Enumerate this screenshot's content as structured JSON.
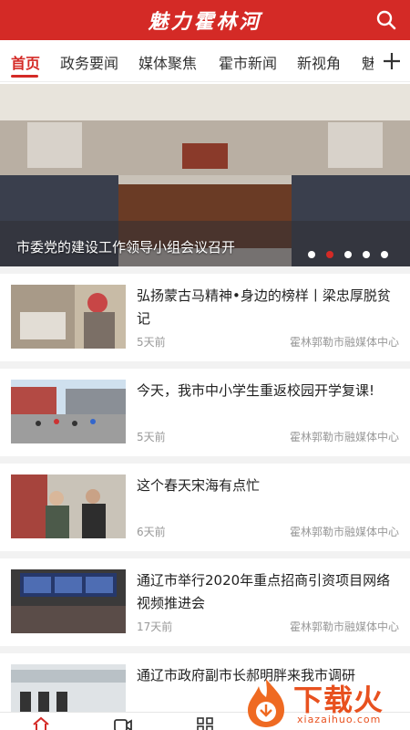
{
  "header": {
    "title": "魅力霍林河",
    "search_icon": "search-icon",
    "bg_color": "#d42a26"
  },
  "tabs": [
    {
      "label": "首页",
      "active": true
    },
    {
      "label": "政务要闻"
    },
    {
      "label": "媒体聚焦"
    },
    {
      "label": "霍市新闻"
    },
    {
      "label": "新视角"
    },
    {
      "label": "魅"
    }
  ],
  "add_tab_icon": "plus-icon",
  "banner": {
    "caption": "市委党的建设工作领导小组会议召开",
    "dots": 5,
    "active_dot": 2
  },
  "news": [
    {
      "title": "弘扬蒙古马精神•身边的榜样丨梁忠厚脱贫记",
      "time": "5天前",
      "source": "霍林郭勒市融媒体中心"
    },
    {
      "title": "今天，我市中小学生重返校园开学复课!",
      "time": "5天前",
      "source": "霍林郭勒市融媒体中心"
    },
    {
      "title": "这个春天宋海有点忙",
      "time": "6天前",
      "source": "霍林郭勒市融媒体中心"
    },
    {
      "title": "通辽市举行2020年重点招商引资项目网络视频推进会",
      "time": "17天前",
      "source": "霍林郭勒市融媒体中心"
    },
    {
      "title": "通辽市政府副市长郝明胖来我市调研",
      "time": "",
      "source": ""
    }
  ],
  "bottom_nav": [
    {
      "icon": "home-icon",
      "active": true
    },
    {
      "icon": "video-icon"
    },
    {
      "icon": "grid-icon"
    }
  ],
  "watermark": {
    "text": "下载火",
    "url": "xiazaihuo.com"
  }
}
